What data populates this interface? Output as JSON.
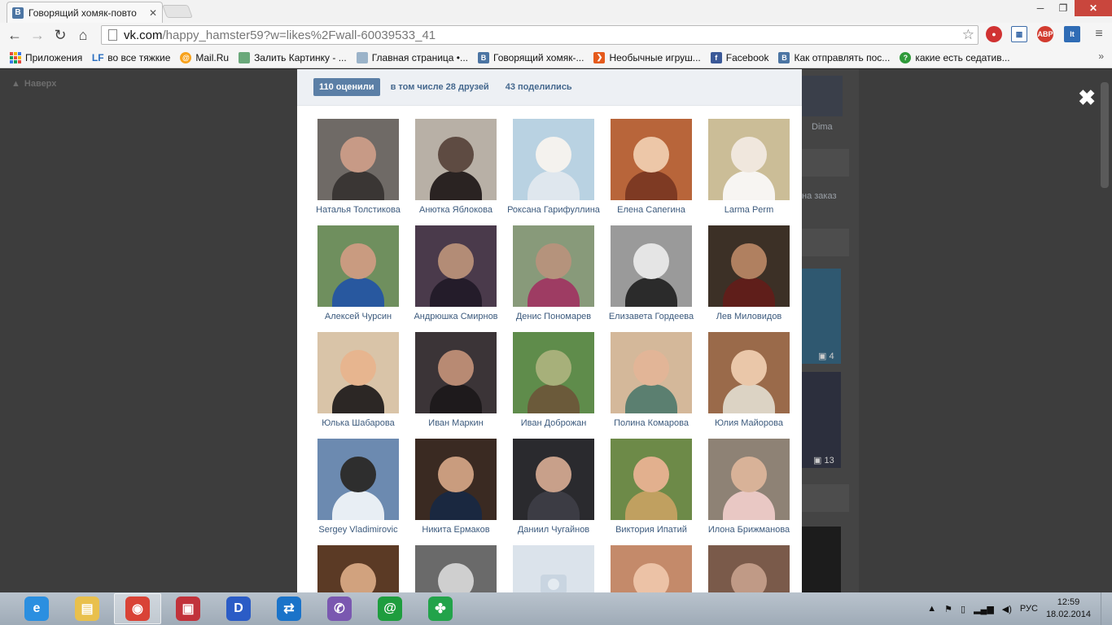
{
  "browser": {
    "tab_title": "Говорящий хомяк-повто",
    "tab_icon": "vk-favicon",
    "url_host": "vk.com",
    "url_path": "/happy_hamster59?w=likes%2Fwall-60039533_41",
    "extensions": [
      "stop-icon",
      "grid-icon",
      "adblock-icon",
      "lt-icon",
      "menu-icon"
    ],
    "adblock_label": "ABP",
    "lt_label": "lt"
  },
  "bookmarks": [
    {
      "label": "Приложения",
      "icon": "apps-icon"
    },
    {
      "label": "во все тяжкие",
      "icon": "lf-icon",
      "icon_text": "LF"
    },
    {
      "label": "Mail.Ru",
      "icon": "mailru-icon",
      "icon_text": "@"
    },
    {
      "label": "Залить Картинку - ...",
      "icon": "image-host-icon"
    },
    {
      "label": "Главная страница •...",
      "icon": "home-page-icon"
    },
    {
      "label": "Говорящий хомяк-...",
      "icon": "vk-icon",
      "icon_text": "B"
    },
    {
      "label": "Необычные игруш...",
      "icon": "toy-shop-icon",
      "icon_text": "❯"
    },
    {
      "label": "Facebook",
      "icon": "facebook-icon",
      "icon_text": "f"
    },
    {
      "label": "Как отправлять пос...",
      "icon": "vk-icon",
      "icon_text": "B"
    },
    {
      "label": "какие есть седатив...",
      "icon": "question-icon",
      "icon_text": "?"
    }
  ],
  "bookmarks_overflow": "»",
  "background_page": {
    "back_to_top": "Наверх",
    "side_name": "Dima",
    "side_order": "на заказ",
    "photo_count_1": "4",
    "photo_count_2": "13"
  },
  "likes_modal": {
    "tabs": [
      {
        "label": "110 оценили",
        "active": true
      },
      {
        "label": "в том числе 28 друзей",
        "active": false
      },
      {
        "label": "43 поделились",
        "active": false
      }
    ],
    "users": [
      {
        "name": "Наталья Толстикова",
        "bg": "#6f6a66",
        "fg": "#c79a86",
        "body": "#3a3634"
      },
      {
        "name": "Анютка Яблокова",
        "bg": "#b8b0a6",
        "fg": "#5e4b42",
        "body": "#2a2322"
      },
      {
        "name": "Роксана Гарифуллина",
        "bg": "#b9d2e2",
        "fg": "#f4f2ee",
        "body": "#dfe7ee"
      },
      {
        "name": "Елена Сапегина",
        "bg": "#b8653a",
        "fg": "#edc7a8",
        "body": "#7e3a23"
      },
      {
        "name": "Larma Perm",
        "bg": "#cbbd97",
        "fg": "#f0e7dd",
        "body": "#f7f5f2"
      },
      {
        "name": "Алексей Чурсин",
        "bg": "#6f8f5e",
        "fg": "#c99b80",
        "body": "#28589f"
      },
      {
        "name": "Андрюшка Смирнов",
        "bg": "#4a3a4b",
        "fg": "#b38c76",
        "body": "#241c2a"
      },
      {
        "name": "Денис Пономарев",
        "bg": "#889a7a",
        "fg": "#b5937c",
        "body": "#9e3c63"
      },
      {
        "name": "Елизавета Гордеева",
        "bg": "#9a9a9a",
        "fg": "#e5e5e5",
        "body": "#2b2b2b"
      },
      {
        "name": "Лев Миловидов",
        "bg": "#3c3026",
        "fg": "#b08060",
        "body": "#5f1e1a"
      },
      {
        "name": "Юлька Шабарова",
        "bg": "#d9c4a8",
        "fg": "#e7b58f",
        "body": "#2c2725"
      },
      {
        "name": "Иван Маркин",
        "bg": "#3b3437",
        "fg": "#b88a73",
        "body": "#1e1a1c"
      },
      {
        "name": "Иван Доброжан",
        "bg": "#5f8c4b",
        "fg": "#a7b07a",
        "body": "#6b5a3a"
      },
      {
        "name": "Полина Комарова",
        "bg": "#d4b89a",
        "fg": "#e2b597",
        "body": "#5b7f70"
      },
      {
        "name": "Юлия Майорова",
        "bg": "#9a6a4a",
        "fg": "#eac7a9",
        "body": "#dcd3c4"
      },
      {
        "name": "Sergey Vladimirovic",
        "bg": "#6c8ab0",
        "fg": "#2e2e2e",
        "body": "#e8eef4"
      },
      {
        "name": "Никита Ермаков",
        "bg": "#3a2a22",
        "fg": "#c99c7e",
        "body": "#1a2840"
      },
      {
        "name": "Даниил Чугайнов",
        "bg": "#2a2a2e",
        "fg": "#c8a08a",
        "body": "#3c3c44"
      },
      {
        "name": "Виктория Ипатий",
        "bg": "#6d8a48",
        "fg": "#e2b08e",
        "body": "#c0a060"
      },
      {
        "name": "Илона Брижманова",
        "bg": "#8e8275",
        "fg": "#d8b298",
        "body": "#e9c8c4"
      },
      {
        "name": "",
        "bg": "#5b3a25",
        "fg": "#d1a27e",
        "body": "#1c1c1c"
      },
      {
        "name": "",
        "bg": "#6a6a6a",
        "fg": "#cfcfcf",
        "body": "#2f2f2f"
      },
      {
        "name": "",
        "placeholder": true,
        "bg": "#dbe3eb",
        "fg": "#dbe3eb",
        "body": "#dbe3eb"
      },
      {
        "name": "",
        "bg": "#c48a6a",
        "fg": "#ecc2a6",
        "body": "#8a4c3c"
      },
      {
        "name": "",
        "bg": "#7a5a4a",
        "fg": "#c09a86",
        "body": "#3a2a2a"
      }
    ]
  },
  "taskbar": {
    "apps": [
      {
        "name": "internet-explorer-icon",
        "color": "#2b8fe0",
        "glyph": "e"
      },
      {
        "name": "file-explorer-icon",
        "color": "#e9c04c",
        "glyph": "▤"
      },
      {
        "name": "chrome-icon",
        "color": "#d94336",
        "glyph": "◉",
        "active": true
      },
      {
        "name": "floppy-app-icon",
        "color": "#c1323b",
        "glyph": "▣"
      },
      {
        "name": "d-app-icon",
        "color": "#2b5cc6",
        "glyph": "D"
      },
      {
        "name": "teamviewer-icon",
        "color": "#1a73c9",
        "glyph": "⇄"
      },
      {
        "name": "viber-icon",
        "color": "#7a58b0",
        "glyph": "✆"
      },
      {
        "name": "mail-agent-icon",
        "color": "#1e9d3e",
        "glyph": "@"
      },
      {
        "name": "clover-app-icon",
        "color": "#22a34a",
        "glyph": "✤"
      }
    ],
    "language": "РУС",
    "time": "12:59",
    "date": "18.02.2014"
  }
}
